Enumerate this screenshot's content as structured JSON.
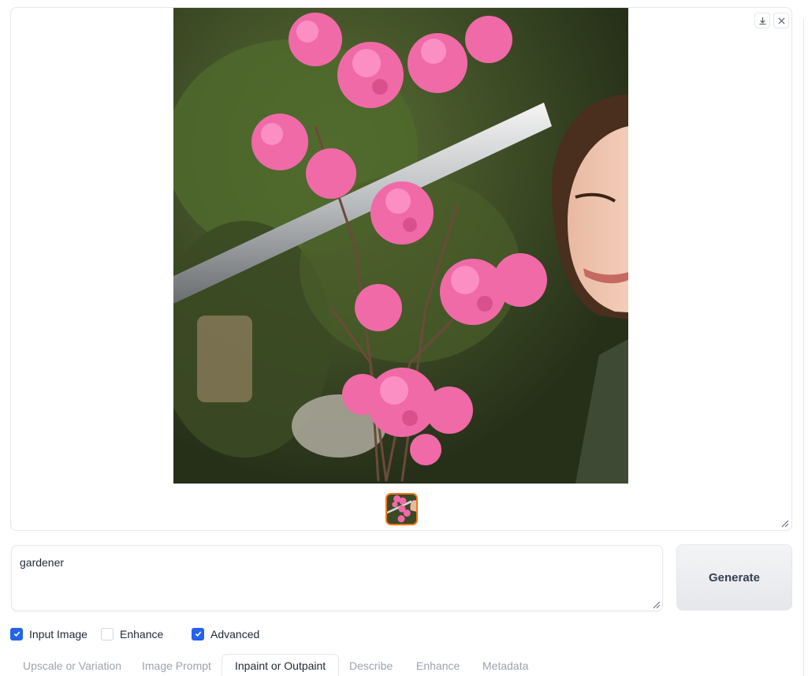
{
  "gallery": {
    "download_icon": "download-icon",
    "close_icon": "close-icon",
    "image_subject": "pink flowers and woman in garden"
  },
  "prompt": {
    "value": "gardener"
  },
  "generate": {
    "label": "Generate"
  },
  "options": {
    "input_image": {
      "label": "Input Image",
      "checked": true
    },
    "enhance": {
      "label": "Enhance",
      "checked": false
    },
    "advanced": {
      "label": "Advanced",
      "checked": true
    }
  },
  "tabs": [
    {
      "label": "Upscale or Variation",
      "active": false
    },
    {
      "label": "Image Prompt",
      "active": false
    },
    {
      "label": "Inpaint or Outpaint",
      "active": true
    },
    {
      "label": "Describe",
      "active": false
    },
    {
      "label": "Enhance",
      "active": false
    },
    {
      "label": "Metadata",
      "active": false
    }
  ],
  "colors": {
    "accent": "#2563eb",
    "selected_thumb_border": "#f97316"
  }
}
